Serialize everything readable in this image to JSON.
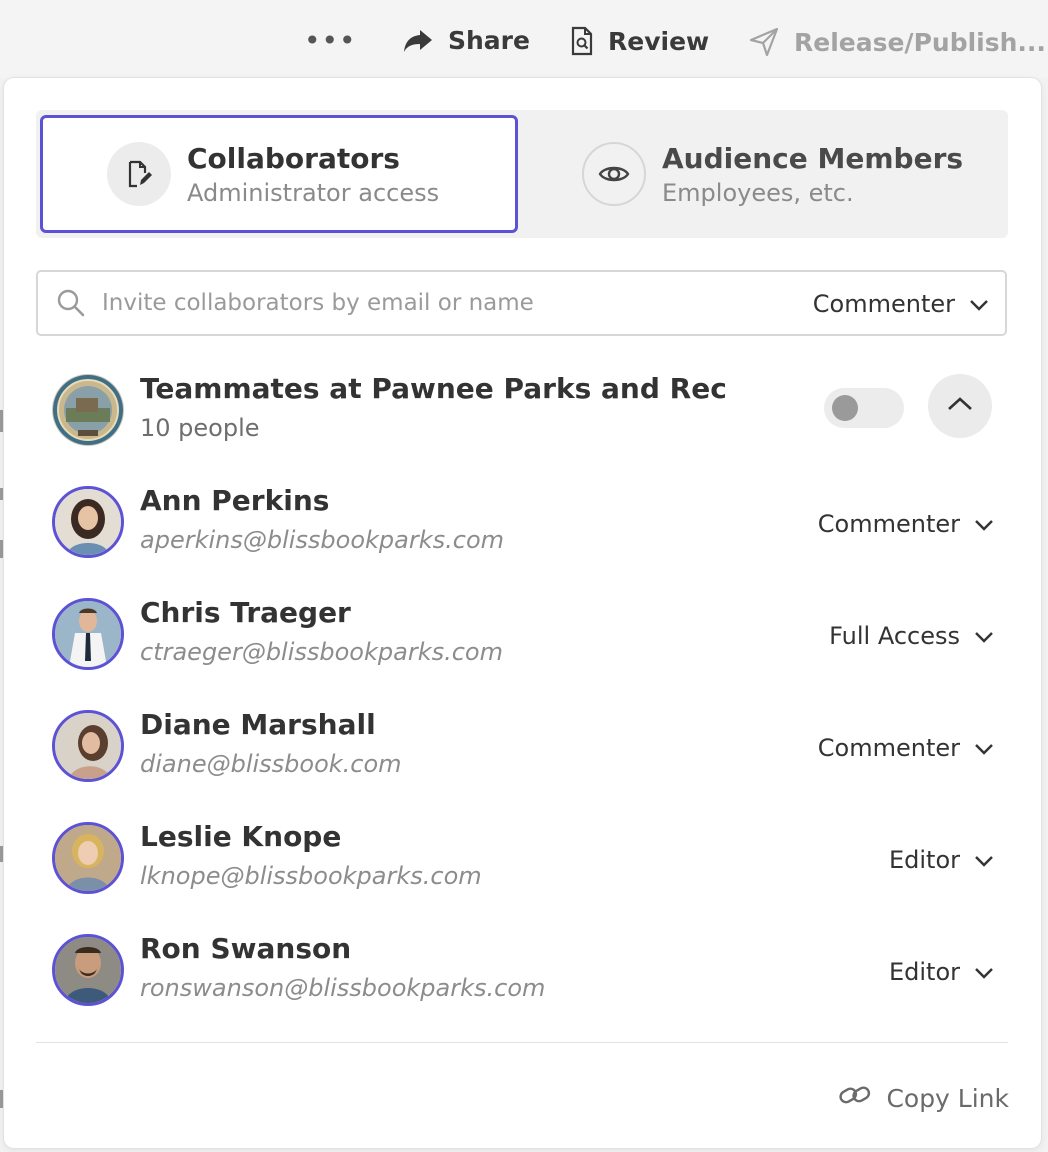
{
  "toolbar": {
    "more_label": "•••",
    "share_label": "Share",
    "review_label": "Review",
    "release_label": "Release/Publish..."
  },
  "tabs": {
    "collaborators": {
      "title": "Collaborators",
      "subtitle": "Administrator access"
    },
    "audience": {
      "title": "Audience Members",
      "subtitle": "Employees, etc."
    }
  },
  "search": {
    "placeholder": "Invite collaborators by email or name",
    "role": "Commenter"
  },
  "team": {
    "name": "Teammates at Pawnee Parks and Rec",
    "count": "10 people",
    "toggle_on": false
  },
  "people": [
    {
      "name": "Ann Perkins",
      "email": "aperkins@blissbookparks.com",
      "role": "Commenter"
    },
    {
      "name": "Chris Traeger",
      "email": "ctraeger@blissbookparks.com",
      "role": "Full Access"
    },
    {
      "name": "Diane Marshall",
      "email": "diane@blissbook.com",
      "role": "Commenter"
    },
    {
      "name": "Leslie Knope",
      "email": "lknope@blissbookparks.com",
      "role": "Editor"
    },
    {
      "name": "Ron Swanson",
      "email": "ronswanson@blissbookparks.com",
      "role": "Editor"
    }
  ],
  "footer": {
    "copy_link_label": "Copy Link"
  },
  "colors": {
    "accent": "#5b52d6",
    "muted_text": "#8c8c8c"
  }
}
